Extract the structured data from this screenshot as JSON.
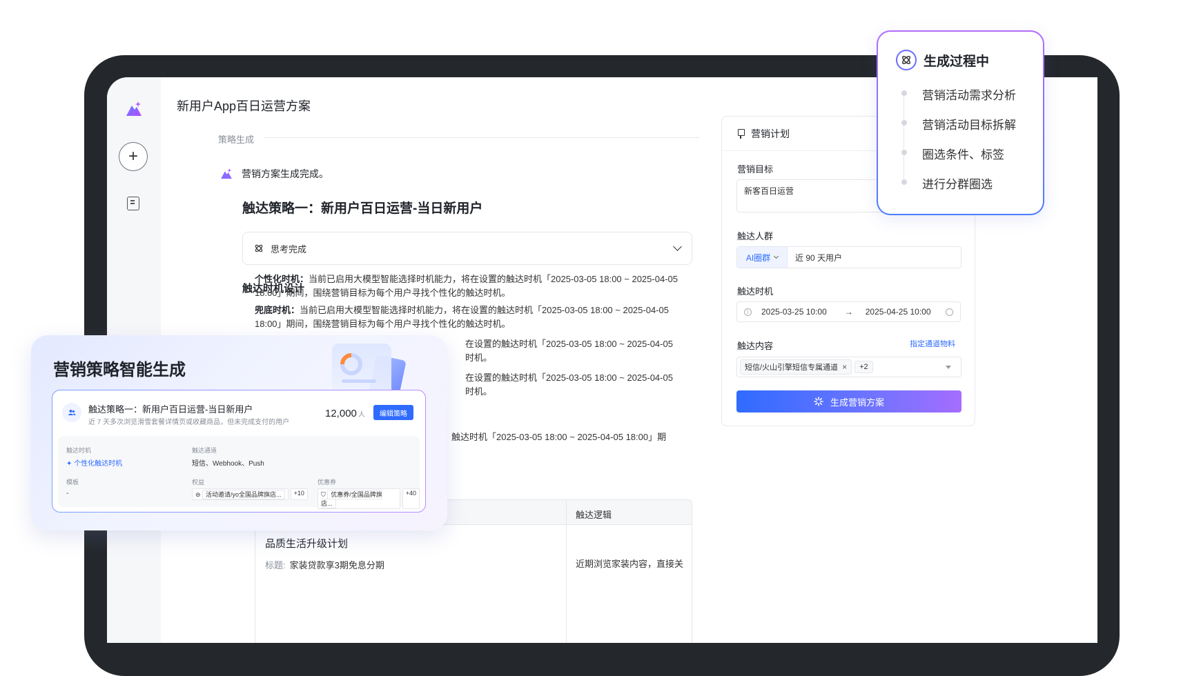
{
  "document": {
    "title": "新用户App百日运营方案",
    "section_label": "策略生成",
    "ai_status": "营销方案生成完成。",
    "strategy_title": "触达策略一：新用户百日运营-当日新用户",
    "think_label": "思考完成",
    "timing_heading": "触达时机设计",
    "p1_key": "个性化时机：",
    "p1_text": "当前已启用大模型智能选择时机能力，将在设置的触达时机「2025-03-05 18:00 ~ 2025-04-05 18:00」期间，围绕营销目标为每个用户寻找个性化的触达时机。",
    "p2_key": "兜底时机：",
    "p2_text": "当前已启用大模型智能选择时机能力，将在设置的触达时机「2025-03-05 18:00 ~ 2025-04-05 18:00」期间，围绕营销目标为每个用户寻找个性化的触达时机。",
    "p3_line1": "在设置的触达时机「2025-03-05 18:00 ~ 2025-04-05",
    "p3_line2": "时机。",
    "p4_line1": "在设置的触达时机「2025-03-05 18:00 ~ 2025-04-05",
    "p4_line2": "时机。",
    "p5_line1": "触达时机「2025-03-05 18:00 ~ 2025-04-05 18:00」期",
    "table": {
      "logic_header": "触达逻辑",
      "row_title": "品质生活升级计划",
      "row_sub_key": "标题:",
      "row_sub_val": "家装贷款享3期免息分期",
      "row_logic": "近期浏览家装内容，直接关"
    }
  },
  "plan": {
    "header": "营销计划",
    "goal_label": "营销目标",
    "goal_value": "新客百日运营",
    "crowd_label": "触达人群",
    "crowd_mode": "AI圈群",
    "crowd_value": "近 90 天用户",
    "time_label": "触达时机",
    "time_start": "2025-03-25 10:00",
    "time_arrow": "→",
    "time_end": "2025-04-25 10:00",
    "content_label": "触达内容",
    "content_link": "指定通道物料",
    "content_tag": "短信/火山引擎短信专属通道",
    "content_more": "+2",
    "generate_button": "生成营销方案"
  },
  "process": {
    "title": "生成过程中",
    "steps": [
      "营销活动需求分析",
      "营销活动目标拆解",
      "圈选条件、标签",
      "进行分群圈选"
    ]
  },
  "smart": {
    "title": "营销策略智能生成",
    "card_title": "触达策略一：新用户百日运营-当日新用户",
    "card_sub": "近 7 天多次浏览滑雪套餐详情页或收藏商品，但未完成支付的用户",
    "count": "12,000",
    "count_unit": "人",
    "edit_button": "编辑策略",
    "timing_label": "触达时机",
    "timing_value": "个性化触达时机",
    "channel_label": "触达通道",
    "channel_value": "短信、Webhook、Push",
    "template_label": "模板",
    "template_value": "-",
    "rights_label": "权益",
    "rights_value": "活动邀请/yo全国品牌旗店...",
    "rights_more": "+10",
    "coupon_label": "优惠券",
    "coupon_value": "优惠券/全国品牌旗店...",
    "coupon_more": "+40"
  },
  "colors": {
    "accent": "#2f6bff",
    "purple": "#a56dff",
    "frame": "#24282c"
  }
}
